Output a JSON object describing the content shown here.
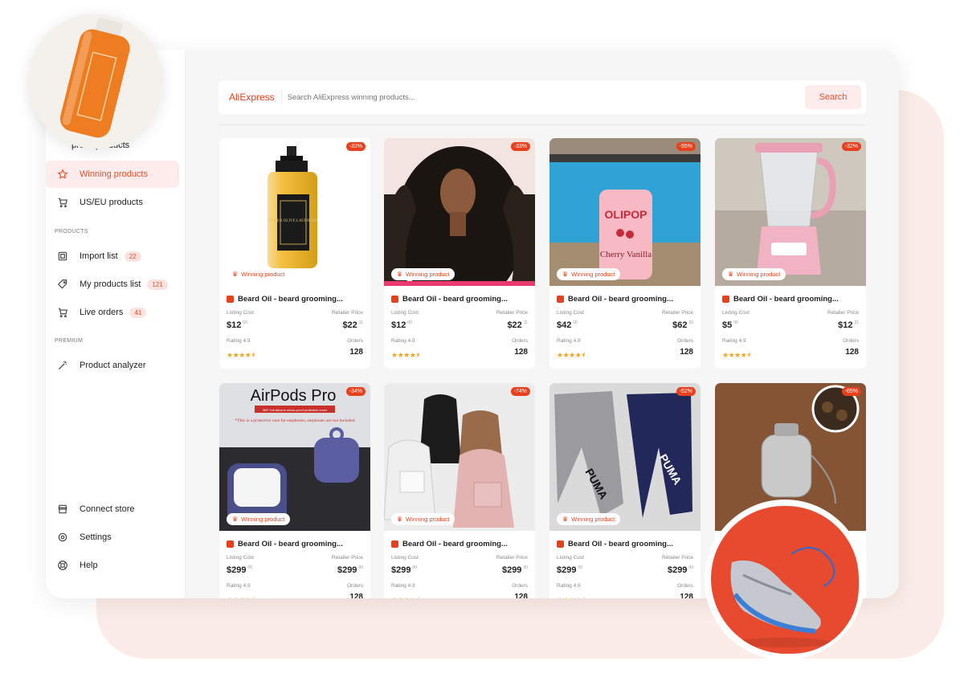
{
  "colors": {
    "accent": "#e8401c",
    "accent_bg": "#fdeceb",
    "bg": "#f6f6f6"
  },
  "sidebar": {
    "items_top": [
      {
        "label": "AliExpress products",
        "visible_label": "press products",
        "icon": "cart-icon"
      },
      {
        "label": "Winning products",
        "icon": "star-icon",
        "active": true
      },
      {
        "label": "US/EU products",
        "icon": "cart-icon"
      }
    ],
    "section_products": "PRODUCTS",
    "products_items": [
      {
        "label": "Import list",
        "count": "22",
        "icon": "import-icon"
      },
      {
        "label": "My products list",
        "count": "121",
        "icon": "tag-icon"
      },
      {
        "label": "Live orders",
        "count": "41",
        "icon": "cart-icon"
      }
    ],
    "section_premium": "PREMIUM",
    "premium_items": [
      {
        "label": "Product analyzer",
        "icon": "magic-wand-icon"
      }
    ],
    "bottom_items": [
      {
        "label": "Connect store",
        "icon": "store-icon"
      },
      {
        "label": "Settings",
        "icon": "gear-icon"
      },
      {
        "label": "Help",
        "icon": "lifebuoy-icon"
      }
    ]
  },
  "search": {
    "logo": "AliExpress",
    "placeholder": "Search AliExpress winning products...",
    "button": "Search"
  },
  "labels": {
    "badge": "Winning product",
    "listing": "Listing Cost",
    "retail": "Retailer Price",
    "rating": "Rating",
    "orders": "Orders"
  },
  "products": [
    {
      "title": "Beard Oil - beard grooming...",
      "discount": "-33%",
      "listing": "$12",
      "listing_c": "00",
      "retail": "$22",
      "retail_c": "11",
      "rating": "4.9",
      "stars": "★★★★⯨",
      "orders": "128",
      "badge": true,
      "image": "oil-bottle"
    },
    {
      "title": "Beard Oil - beard grooming...",
      "discount": "-33%",
      "listing": "$12",
      "listing_c": "00",
      "retail": "$22",
      "retail_c": "11",
      "rating": "4.9",
      "stars": "★★★★⯨",
      "orders": "128",
      "badge": true,
      "image": "wig"
    },
    {
      "title": "Beard Oil - beard grooming...",
      "discount": "-55%",
      "listing": "$42",
      "listing_c": "00",
      "retail": "$62",
      "retail_c": "33",
      "rating": "4.9",
      "stars": "★★★★⯨",
      "orders": "128",
      "badge": true,
      "image": "soda-can"
    },
    {
      "title": "Beard Oil - beard grooming...",
      "discount": "-32%",
      "listing": "$5",
      "listing_c": "00",
      "retail": "$12",
      "retail_c": "21",
      "rating": "4.9",
      "stars": "★★★★⯨",
      "orders": "128",
      "badge": true,
      "image": "blender"
    },
    {
      "title": "Beard Oil - beard grooming...",
      "discount": "-34%",
      "listing": "$299",
      "listing_c": "00",
      "retail": "$299",
      "retail_c": "00",
      "rating": "4.9",
      "stars": "★★★★⯨",
      "orders": "128",
      "badge": true,
      "image": "airpods"
    },
    {
      "title": "Beard Oil - beard grooming...",
      "discount": "-74%",
      "listing": "$299",
      "listing_c": "00",
      "retail": "$299",
      "retail_c": "00",
      "rating": "4.9",
      "stars": "★★★★⯨",
      "orders": "128",
      "badge": true,
      "image": "backpacks"
    },
    {
      "title": "Beard Oil - beard grooming...",
      "discount": "-52%",
      "listing": "$299",
      "listing_c": "00",
      "retail": "$299",
      "retail_c": "00",
      "rating": "4.9",
      "stars": "★★★★⯨",
      "orders": "128",
      "badge": true,
      "image": "pants"
    },
    {
      "title": "",
      "discount": "-65%",
      "listing": "",
      "listing_c": "",
      "retail": "",
      "retail_c": "",
      "rating": "",
      "stars": "",
      "orders": "",
      "badge": false,
      "image": "tea-infuser"
    }
  ],
  "images": {
    "airpods_text": "AirPods Pro",
    "airpods_sub": "360° full silicone shock-proof protective cover",
    "airpods_note": "*This is a protective case for earphones, earphones are not included",
    "soda_brand": "OLIPOP",
    "soda_flavor": "Cherry Vanilla",
    "pants_brand": "PUMA",
    "bottle_label": "GREEN OLIVE LAVENDER"
  }
}
